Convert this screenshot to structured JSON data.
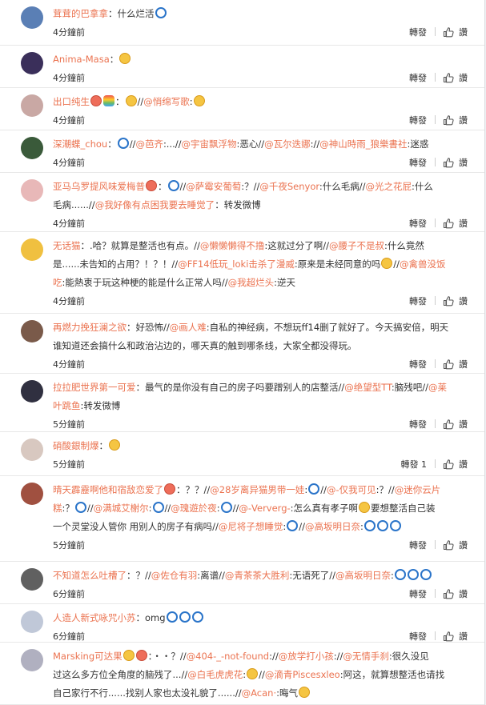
{
  "actions": {
    "forward": "轉發",
    "like": "讚"
  },
  "colors": {
    "mention": "#eb7350",
    "text": "#333333",
    "time": "#333333"
  },
  "comments": [
    {
      "avatar_color": "#5a7fb5",
      "user": "茸茸的巴拿拿",
      "content_parts": [
        {
          "k": "t",
          "v": "：什么烂活"
        },
        {
          "k": "e",
          "v": "blue"
        }
      ],
      "time": "4分鐘前",
      "forward": "轉發"
    },
    {
      "avatar_color": "#3a2f5a",
      "user": "Anima-Masa",
      "content_parts": [
        {
          "k": "t",
          "v": "："
        },
        {
          "k": "e",
          "v": "yellow"
        }
      ],
      "time": "4分鐘前",
      "forward": "轉發"
    },
    {
      "avatar_color": "#c9a8a4",
      "user": "出口纯生",
      "content_parts": [
        {
          "k": "e",
          "v": "red"
        },
        {
          "k": "e",
          "v": "rainbow"
        },
        {
          "k": "t",
          "v": "："
        },
        {
          "k": "e",
          "v": "yellow"
        },
        {
          "k": "t",
          "v": "//"
        },
        {
          "k": "m",
          "v": "@悄绵写歌"
        },
        {
          "k": "t",
          "v": ":"
        },
        {
          "k": "e",
          "v": "yellow"
        }
      ],
      "time": "4分鐘前",
      "forward": "轉發"
    },
    {
      "avatar_color": "#3a5a3a",
      "user": "深潮蝶_chou",
      "content_parts": [
        {
          "k": "t",
          "v": "："
        },
        {
          "k": "e",
          "v": "blue"
        },
        {
          "k": "t",
          "v": "//"
        },
        {
          "k": "m",
          "v": "@芭齐"
        },
        {
          "k": "t",
          "v": ":...//"
        },
        {
          "k": "m",
          "v": "@宇宙飘浮物"
        },
        {
          "k": "t",
          "v": ":恶心//"
        },
        {
          "k": "m",
          "v": "@瓦尔迭娜"
        },
        {
          "k": "t",
          "v": "://"
        },
        {
          "k": "m",
          "v": "@神山時雨_狼樂書社"
        },
        {
          "k": "t",
          "v": ":迷惑"
        }
      ],
      "time": "4分鐘前",
      "forward": "轉發"
    },
    {
      "avatar_color": "#e8b8b8",
      "user": "亚马乌罗提风味爱梅普",
      "content_parts": [
        {
          "k": "e",
          "v": "red"
        },
        {
          "k": "t",
          "v": "："
        },
        {
          "k": "e",
          "v": "blue"
        },
        {
          "k": "t",
          "v": "//"
        },
        {
          "k": "m",
          "v": "@萨霉安葡萄"
        },
        {
          "k": "t",
          "v": ":？//"
        },
        {
          "k": "m",
          "v": "@千夜Senyor"
        },
        {
          "k": "t",
          "v": ":什么毛病//"
        },
        {
          "k": "m",
          "v": "@光之花屁"
        },
        {
          "k": "t",
          "v": ":什么"
        }
      ],
      "content2_parts": [
        {
          "k": "t",
          "v": "毛病......//"
        },
        {
          "k": "m",
          "v": "@我好像有点困我要去睡觉了"
        },
        {
          "k": "t",
          "v": "：转发微博"
        }
      ],
      "time": "4分鐘前",
      "forward": "轉發"
    },
    {
      "avatar_color": "#f0c040",
      "user": "无话猫",
      "content_parts": [
        {
          "k": "t",
          "v": "：.哈？就算是整活也有点。//"
        },
        {
          "k": "m",
          "v": "@懒懒懒得不撸"
        },
        {
          "k": "t",
          "v": ":这就过分了啊//"
        },
        {
          "k": "m",
          "v": "@腰子不是叔"
        },
        {
          "k": "t",
          "v": ":什么竟然"
        }
      ],
      "content2_parts": [
        {
          "k": "t",
          "v": "是......未告知的占用？！？！//"
        },
        {
          "k": "m",
          "v": "@FF14低玩_loki击杀了漫威"
        },
        {
          "k": "t",
          "v": ":原来是未经同意的吗"
        },
        {
          "k": "e",
          "v": "yellow"
        },
        {
          "k": "t",
          "v": "//"
        },
        {
          "k": "m",
          "v": "@禽兽没饭"
        }
      ],
      "content3_parts": [
        {
          "k": "m",
          "v": "吃"
        },
        {
          "k": "t",
          "v": ":能熱衷于玩这种梗的能是什么正常人吗//"
        },
        {
          "k": "m",
          "v": "@我超烂头"
        },
        {
          "k": "t",
          "v": ":逆天"
        }
      ],
      "time": "4分鐘前",
      "forward": "轉發"
    },
    {
      "avatar_color": "#7a5a4a",
      "user": "再燃力挽狂澜之欲",
      "content_parts": [
        {
          "k": "t",
          "v": "：好恐怖//"
        },
        {
          "k": "m",
          "v": "@画人难"
        },
        {
          "k": "t",
          "v": ":自私的神经病，不想玩ff14删了就好了。今天搞安倍，明天"
        }
      ],
      "content2_parts": [
        {
          "k": "t",
          "v": "谁知道还会搞什么和政治沾边的，哪天真的触到哪条线，大家全都没得玩。"
        }
      ],
      "time": "4分鐘前",
      "forward": "轉發"
    },
    {
      "avatar_color": "#303040",
      "user": "拉拉肥世界第一可爱",
      "content_parts": [
        {
          "k": "t",
          "v": "：最气的是你没有自己的房子吗要蹭别人的店整活//"
        },
        {
          "k": "m",
          "v": "@绝望型TT"
        },
        {
          "k": "t",
          "v": ":脑残吧//"
        },
        {
          "k": "m",
          "v": "@莱"
        }
      ],
      "content2_parts": [
        {
          "k": "m",
          "v": "叶跳鱼"
        },
        {
          "k": "t",
          "v": ":转发微博"
        }
      ],
      "time": "5分鐘前",
      "forward": "轉發"
    },
    {
      "avatar_color": "#d8c8c0",
      "user": "硝酸銀制爆",
      "content_parts": [
        {
          "k": "t",
          "v": "："
        },
        {
          "k": "e",
          "v": "yellow"
        }
      ],
      "time": "5分鐘前",
      "forward": "轉發 1"
    },
    {
      "avatar_color": "#a05040",
      "user": "晴天霹靂啊他和宿敌恋爱了",
      "content_parts": [
        {
          "k": "e",
          "v": "red"
        },
        {
          "k": "t",
          "v": "：？？//"
        },
        {
          "k": "m",
          "v": "@28岁离异猫男带一娃"
        },
        {
          "k": "t",
          "v": ":"
        },
        {
          "k": "e",
          "v": "blue"
        },
        {
          "k": "t",
          "v": "//"
        },
        {
          "k": "m",
          "v": "@-仅我可见"
        },
        {
          "k": "t",
          "v": ":？//"
        },
        {
          "k": "m",
          "v": "@迷你云片"
        }
      ],
      "content2_parts": [
        {
          "k": "m",
          "v": "糕"
        },
        {
          "k": "t",
          "v": ":？"
        },
        {
          "k": "e",
          "v": "blue"
        },
        {
          "k": "t",
          "v": "//"
        },
        {
          "k": "m",
          "v": "@满城艾榭尔"
        },
        {
          "k": "t",
          "v": ":"
        },
        {
          "k": "e",
          "v": "blue"
        },
        {
          "k": "t",
          "v": "//"
        },
        {
          "k": "m",
          "v": "@瑰遊於夜"
        },
        {
          "k": "t",
          "v": ":"
        },
        {
          "k": "e",
          "v": "blue"
        },
        {
          "k": "t",
          "v": "//"
        },
        {
          "k": "m",
          "v": "@-Ververg-"
        },
        {
          "k": "t",
          "v": ":怎么真有孝子啊"
        },
        {
          "k": "e",
          "v": "yellow"
        },
        {
          "k": "t",
          "v": "要想整活自己装"
        }
      ],
      "content3_parts": [
        {
          "k": "t",
          "v": "一个灵堂没人管你 用别人的房子有病吗//"
        },
        {
          "k": "m",
          "v": "@尼将子想睡觉"
        },
        {
          "k": "t",
          "v": ":"
        },
        {
          "k": "e",
          "v": "blue"
        },
        {
          "k": "t",
          "v": "//"
        },
        {
          "k": "m",
          "v": "@高坂明日奈"
        },
        {
          "k": "t",
          "v": ":"
        },
        {
          "k": "e",
          "v": "blue"
        },
        {
          "k": "e",
          "v": "blue"
        },
        {
          "k": "e",
          "v": "blue"
        }
      ],
      "time": "5分鐘前",
      "forward": "轉發"
    },
    {
      "avatar_color": "#606060",
      "user": "不知道怎么吐槽了",
      "content_parts": [
        {
          "k": "t",
          "v": "：？//"
        },
        {
          "k": "m",
          "v": "@佐仓有羽"
        },
        {
          "k": "t",
          "v": ":离谱//"
        },
        {
          "k": "m",
          "v": "@青茶茶大胜利"
        },
        {
          "k": "t",
          "v": ":无语死了//"
        },
        {
          "k": "m",
          "v": "@高坂明日奈"
        },
        {
          "k": "t",
          "v": ":"
        },
        {
          "k": "e",
          "v": "blue"
        },
        {
          "k": "e",
          "v": "blue"
        },
        {
          "k": "e",
          "v": "blue"
        }
      ],
      "time": "6分鐘前",
      "forward": "轉發"
    },
    {
      "avatar_color": "#c0c8d8",
      "user": "人造人新式咏咒小苏",
      "content_parts": [
        {
          "k": "t",
          "v": "：omg"
        },
        {
          "k": "e",
          "v": "blue"
        },
        {
          "k": "e",
          "v": "blue"
        },
        {
          "k": "e",
          "v": "blue"
        }
      ],
      "time": "6分鐘前",
      "forward": "轉發"
    },
    {
      "avatar_color": "#b0b0c0",
      "user": "Marsking可达果",
      "content_parts": [
        {
          "k": "e",
          "v": "yellow"
        },
        {
          "k": "e",
          "v": "red"
        },
        {
          "k": "t",
          "v": "：・・？//"
        },
        {
          "k": "m",
          "v": "@404-_-not-found"
        },
        {
          "k": "t",
          "v": "://"
        },
        {
          "k": "m",
          "v": "@放学打小孩"
        },
        {
          "k": "t",
          "v": "://"
        },
        {
          "k": "m",
          "v": "@无情手刹"
        },
        {
          "k": "t",
          "v": ":很久没见"
        }
      ],
      "content2_parts": [
        {
          "k": "t",
          "v": "过这么多方位全角度的脑残了...//"
        },
        {
          "k": "m",
          "v": "@白毛虎虎花"
        },
        {
          "k": "t",
          "v": ":"
        },
        {
          "k": "e",
          "v": "yellow"
        },
        {
          "k": "t",
          "v": "//"
        },
        {
          "k": "m",
          "v": "@滴青Piscesxleo"
        },
        {
          "k": "t",
          "v": ":阿这，就算想整活也请找"
        }
      ],
      "content3_parts": [
        {
          "k": "t",
          "v": "自己家行不行......找别人家也太没礼貌了......//"
        },
        {
          "k": "m",
          "v": "@Acan·"
        },
        {
          "k": "t",
          "v": ":晦气"
        },
        {
          "k": "e",
          "v": "yellow"
        }
      ]
    }
  ]
}
